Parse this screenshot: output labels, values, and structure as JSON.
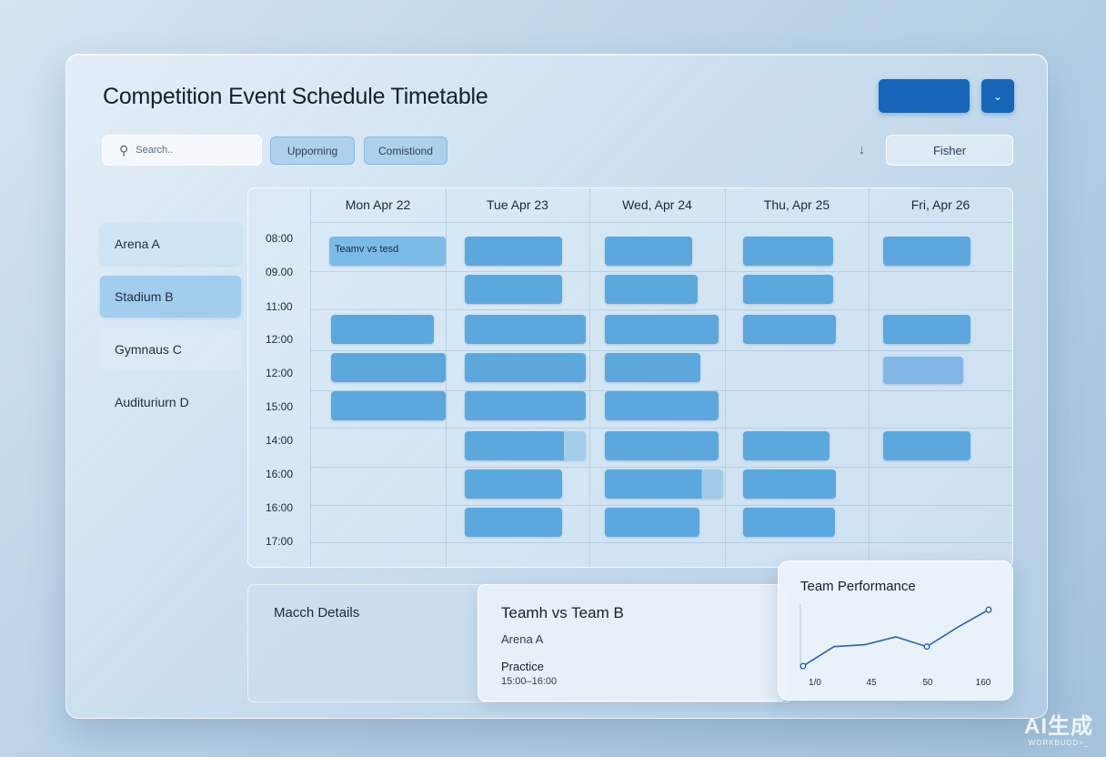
{
  "header": {
    "title": "Competition Event Schedule Timetable"
  },
  "toolbar": {
    "search_placeholder": "Search..",
    "chips": [
      "Upporning",
      "Comistiond"
    ],
    "filter_label": "Fisher"
  },
  "venues": [
    "Arena A",
    "Stadium B",
    "Gymnaus C",
    "Audituriurn D"
  ],
  "schedule": {
    "days": [
      "Mon Apr 22",
      "Tue Apr 23",
      "Wed, Apr 24",
      "Thu, Apr 25",
      "Fri, Apr 26"
    ],
    "times": [
      "08:00",
      "09.00",
      "11:00",
      "12:00",
      "12:00",
      "15:00",
      "14:00",
      "16:00",
      "16:00",
      "17:00"
    ],
    "event_label": "Teamv vs tesd"
  },
  "match_details": {
    "heading": "Macch Details",
    "title": "Teamh vs Team B",
    "venue": "Arena A",
    "type": "Practice",
    "time": "15:00–16:00"
  },
  "team_performance": {
    "title": "Team Performance",
    "chart_data": {
      "type": "line",
      "title": "Team Performance",
      "categories": [
        "1/0",
        "45",
        "50",
        "160"
      ],
      "series": [
        {
          "values": [
            0,
            20,
            22,
            30,
            20,
            40,
            58
          ]
        }
      ],
      "ylim": [
        0,
        60
      ],
      "grid": false
    }
  },
  "watermark": {
    "line1": "AI生成",
    "line2": "WORKBUDD>_"
  },
  "colors": {
    "primary": "#1565b8",
    "event": "#5ba8df",
    "line": "#2a63a8"
  }
}
